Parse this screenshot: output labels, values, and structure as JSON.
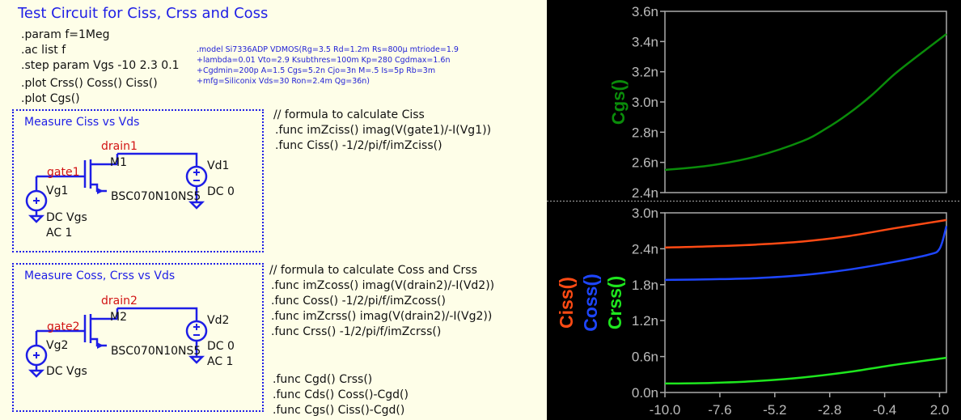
{
  "schematic": {
    "title": "Test Circuit for Ciss, Crss and Coss",
    "directives": [
      ".param f=1Meg",
      ".ac list f",
      ".step param Vgs -10 2.3 0.1",
      ".plot Crss() Coss() Ciss()",
      ".plot Cgs()"
    ],
    "model_lines": [
      ".model Si7336ADP VDMOS(Rg=3.5 Rd=1.2m Rs=800µ mtriode=1.9",
      "+lambda=0.01 Vto=2.9 Ksubthres=100m Kp=280 Cgdmax=1.6n",
      "+Cgdmin=200p A=1.5 Cgs=5.2n Cjo=3n M=.5 Is=5p Rb=3m",
      "+mfg=Siliconix Vds=30 Ron=2.4m Qg=36n)"
    ],
    "box1": {
      "title": "Measure Ciss vs Vds",
      "drain_net": "drain1",
      "gate_net": "gate1",
      "mosfet": "M1",
      "part": "BSC070N10NS5",
      "vs_gate": "Vg1",
      "vs_drain": "Vd1",
      "vs_drain_value": "DC 0",
      "gate_value_1": "DC Vgs",
      "gate_value_2": "AC 1"
    },
    "box2": {
      "title": "Measure Coss, Crss vs Vds",
      "drain_net": "drain2",
      "gate_net": "gate2",
      "mosfet": "M2",
      "part": "BSC070N10NS5",
      "vs_gate": "Vg2",
      "vs_drain": "Vd2",
      "vs_drain_value_1": "DC 0",
      "vs_drain_value_2": "AC 1",
      "gate_value": "DC Vgs"
    },
    "ciss_comment": "// formula to calculate Ciss",
    "ciss_funcs": [
      ".func imZciss() imag(V(gate1)/-I(Vg1))",
      ".func Ciss() -1/2/pi/f/imZciss()"
    ],
    "coss_comment": "// formula to calculate Coss and Crss",
    "coss_funcs": [
      ".func imZcoss() imag(V(drain2)/-I(Vd2))",
      ".func Coss() -1/2/pi/f/imZcoss()",
      ".func imZcrss() imag(V(drain2)/-I(Vg2))",
      ".func Crss() -1/2/pi/f/imZcrss()"
    ],
    "cap_funcs": [
      ".func Cgd() Crss()",
      ".func Cds() Coss()-Cgd()",
      ".func Cgs() Ciss()-Cgd()"
    ]
  },
  "colors": {
    "ciss": "#ff4a14",
    "coss": "#1e46ff",
    "crss": "#1ee61e",
    "cgs": "#0a8c0a",
    "schematic_blue": "#1e1ee6",
    "net_label_red": "#d21414"
  },
  "chart_data": [
    {
      "type": "line",
      "ylabel": "Cgs()",
      "ylim": [
        2.4,
        3.6
      ],
      "yticks": [
        "3.6n",
        "3.4n",
        "3.2n",
        "3.0n",
        "2.8n",
        "2.6n",
        "2.4n"
      ],
      "series": [
        {
          "name": "Cgs()",
          "color": "#0a8c0a",
          "x": [
            -10.0,
            -8.0,
            -6.0,
            -4.0,
            -3.0,
            -2.0,
            -1.0,
            0.0,
            1.0,
            2.3
          ],
          "values": [
            2.55,
            2.58,
            2.64,
            2.74,
            2.82,
            2.92,
            3.04,
            3.18,
            3.3,
            3.45
          ]
        }
      ]
    },
    {
      "type": "line",
      "ylabels": [
        "Ciss()",
        "Coss()",
        "Crss()"
      ],
      "xlim": [
        -10.0,
        2.3
      ],
      "ylim": [
        0.0,
        3.0
      ],
      "xticks": [
        "-10.0",
        "-7.6",
        "-5.2",
        "-2.8",
        "-0.4",
        "2.0"
      ],
      "yticks": [
        "3.0n",
        "2.4n",
        "1.8n",
        "1.2n",
        "0.6n",
        "0.0n"
      ],
      "series": [
        {
          "name": "Ciss()",
          "color": "#ff4a14",
          "x": [
            -10.0,
            -8.0,
            -6.0,
            -4.0,
            -2.0,
            0.0,
            2.3
          ],
          "values": [
            2.42,
            2.44,
            2.47,
            2.52,
            2.61,
            2.74,
            2.88
          ]
        },
        {
          "name": "Coss()",
          "color": "#1e46ff",
          "x": [
            -10.0,
            -8.0,
            -6.0,
            -4.0,
            -2.0,
            0.0,
            1.5,
            2.0,
            2.3
          ],
          "values": [
            1.88,
            1.89,
            1.91,
            1.96,
            2.05,
            2.18,
            2.3,
            2.4,
            2.78
          ]
        },
        {
          "name": "Crss()",
          "color": "#1ee61e",
          "x": [
            -10.0,
            -8.0,
            -6.0,
            -4.0,
            -2.0,
            0.0,
            2.3
          ],
          "values": [
            0.15,
            0.16,
            0.19,
            0.25,
            0.34,
            0.46,
            0.58
          ]
        }
      ]
    }
  ]
}
